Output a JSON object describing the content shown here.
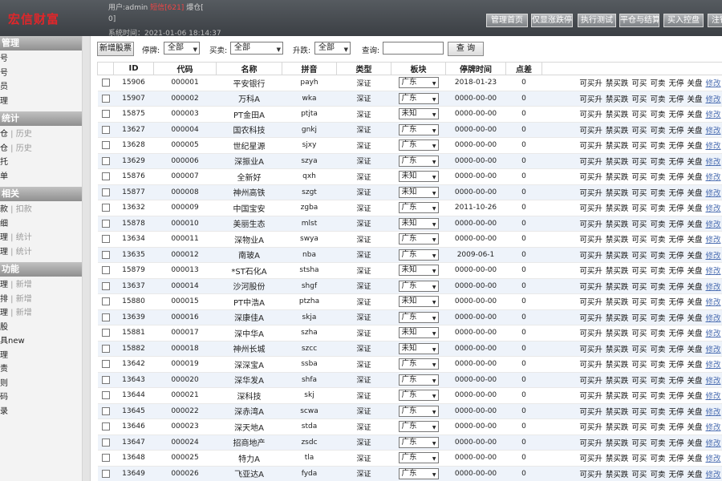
{
  "header": {
    "logo": "宏信财富",
    "user_label": "用户:admin",
    "sms_label": "短信[621]",
    "blast_label": "爆仓[",
    "blast_count": "0]",
    "time_label": "系统时间：2021-01-06 18:14:37",
    "buttons": [
      "管理首页",
      "仅显涨跌停",
      "执行测试",
      "平仓与结算",
      "买入控盘",
      "注销"
    ]
  },
  "sidebar": [
    {
      "title": "管理",
      "items": [
        [
          "号",
          ""
        ],
        [
          "号",
          ""
        ],
        [
          "员",
          ""
        ],
        [
          "理",
          ""
        ]
      ]
    },
    {
      "title": "统计",
      "items": [
        [
          "仓",
          "历史"
        ],
        [
          "仓",
          "历史"
        ],
        [
          "托",
          ""
        ],
        [
          "单",
          ""
        ]
      ]
    },
    {
      "title": "相关",
      "items": [
        [
          "款",
          "扣款"
        ],
        [
          "细",
          ""
        ],
        [
          "理",
          "统计"
        ],
        [
          "理",
          "统计"
        ]
      ]
    },
    {
      "title": "功能",
      "items": [
        [
          "理",
          "新增"
        ],
        [
          "排",
          "新增"
        ],
        [
          "理",
          "新增"
        ],
        [
          "股",
          ""
        ],
        [
          "具new",
          ""
        ],
        [
          "理",
          ""
        ],
        [
          "责",
          ""
        ],
        [
          "则",
          ""
        ],
        [
          "码",
          ""
        ],
        [
          "录",
          ""
        ]
      ]
    }
  ],
  "filters": {
    "add_button": "新增股票",
    "halt_label": "停牌:",
    "halt_value": "全部",
    "trade_label": "买卖:",
    "trade_value": "全部",
    "limit_label": "升跌:",
    "limit_value": "全部",
    "query_label": "查询:",
    "query_value": "",
    "search_button": "查 询"
  },
  "table": {
    "headers": [
      "",
      "ID",
      "代码",
      "名称",
      "拼音",
      "类型",
      "板块",
      "停牌时间",
      "点差",
      ""
    ],
    "ops": [
      "可买升",
      "禁买跌",
      "可买",
      "可卖",
      "无停",
      "关盘",
      "修改"
    ],
    "rows": [
      [
        "15906",
        "000001",
        "平安银行",
        "payh",
        "深证",
        "广东",
        "2018-01-23",
        "0"
      ],
      [
        "15907",
        "000002",
        "万科A",
        "wka",
        "深证",
        "广东",
        "0000-00-00",
        "0"
      ],
      [
        "15875",
        "000003",
        "PT金田A",
        "ptjta",
        "深证",
        "未知",
        "0000-00-00",
        "0"
      ],
      [
        "13627",
        "000004",
        "国农科技",
        "gnkj",
        "深证",
        "广东",
        "0000-00-00",
        "0"
      ],
      [
        "13628",
        "000005",
        "世纪星源",
        "sjxy",
        "深证",
        "广东",
        "0000-00-00",
        "0"
      ],
      [
        "13629",
        "000006",
        "深振业A",
        "szya",
        "深证",
        "广东",
        "0000-00-00",
        "0"
      ],
      [
        "15876",
        "000007",
        "全新好",
        "qxh",
        "深证",
        "未知",
        "0000-00-00",
        "0"
      ],
      [
        "15877",
        "000008",
        "神州高铁",
        "szgt",
        "深证",
        "未知",
        "0000-00-00",
        "0"
      ],
      [
        "13632",
        "000009",
        "中国宝安",
        "zgba",
        "深证",
        "广东",
        "2011-10-26",
        "0"
      ],
      [
        "15878",
        "000010",
        "美丽生态",
        "mlst",
        "深证",
        "未知",
        "0000-00-00",
        "0"
      ],
      [
        "13634",
        "000011",
        "深物业A",
        "swya",
        "深证",
        "广东",
        "0000-00-00",
        "0"
      ],
      [
        "13635",
        "000012",
        "南玻A",
        "nba",
        "深证",
        "广东",
        "2009-06-1",
        "0"
      ],
      [
        "15879",
        "000013",
        "*ST石化A",
        "stsha",
        "深证",
        "未知",
        "0000-00-00",
        "0"
      ],
      [
        "13637",
        "000014",
        "沙河股份",
        "shgf",
        "深证",
        "广东",
        "0000-00-00",
        "0"
      ],
      [
        "15880",
        "000015",
        "PT中浩A",
        "ptzha",
        "深证",
        "未知",
        "0000-00-00",
        "0"
      ],
      [
        "13639",
        "000016",
        "深康佳A",
        "skja",
        "深证",
        "广东",
        "0000-00-00",
        "0"
      ],
      [
        "15881",
        "000017",
        "深中华A",
        "szha",
        "深证",
        "未知",
        "0000-00-00",
        "0"
      ],
      [
        "15882",
        "000018",
        "神州长城",
        "szcc",
        "深证",
        "未知",
        "0000-00-00",
        "0"
      ],
      [
        "13642",
        "000019",
        "深深宝A",
        "ssba",
        "深证",
        "广东",
        "0000-00-00",
        "0"
      ],
      [
        "13643",
        "000020",
        "深华发A",
        "shfa",
        "深证",
        "广东",
        "0000-00-00",
        "0"
      ],
      [
        "13644",
        "000021",
        "深科技",
        "skj",
        "深证",
        "广东",
        "0000-00-00",
        "0"
      ],
      [
        "13645",
        "000022",
        "深赤湾A",
        "scwa",
        "深证",
        "广东",
        "0000-00-00",
        "0"
      ],
      [
        "13646",
        "000023",
        "深天地A",
        "stda",
        "深证",
        "广东",
        "0000-00-00",
        "0"
      ],
      [
        "13647",
        "000024",
        "招商地产",
        "zsdc",
        "深证",
        "广东",
        "0000-00-00",
        "0"
      ],
      [
        "13648",
        "000025",
        "特力A",
        "tla",
        "深证",
        "广东",
        "0000-00-00",
        "0"
      ],
      [
        "13649",
        "000026",
        "飞亚达A",
        "fyda",
        "深证",
        "广东",
        "0000-00-00",
        "0"
      ]
    ]
  }
}
